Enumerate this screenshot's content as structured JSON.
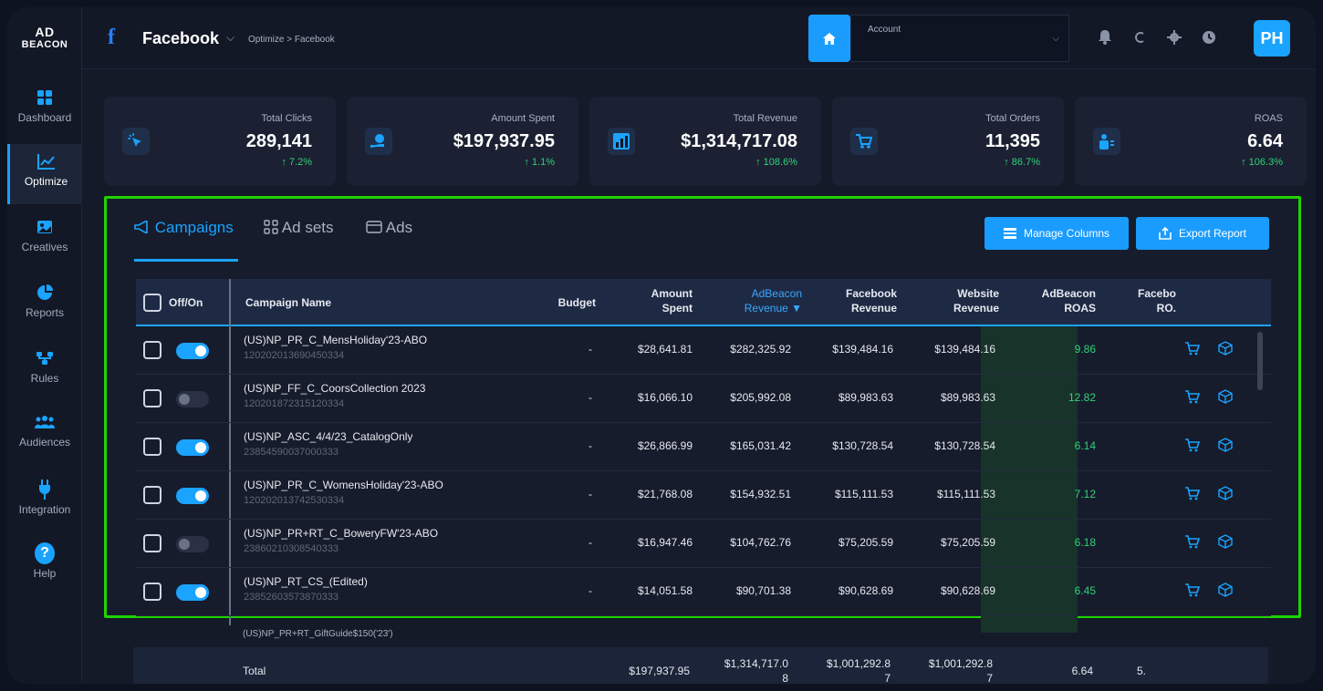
{
  "app": {
    "logo_line1": "AD",
    "logo_line2": "BEACON"
  },
  "sidebar": {
    "items": [
      {
        "label": "Dashboard",
        "icon": "grid-icon"
      },
      {
        "label": "Optimize",
        "icon": "chart-line-icon",
        "active": true
      },
      {
        "label": "Creatives",
        "icon": "image-icon"
      },
      {
        "label": "Reports",
        "icon": "pie-chart-icon"
      },
      {
        "label": "Rules",
        "icon": "flow-icon"
      },
      {
        "label": "Audiences",
        "icon": "users-icon"
      },
      {
        "label": "Integration",
        "icon": "plug-icon"
      },
      {
        "label": "Help",
        "icon": "help-icon"
      }
    ]
  },
  "header": {
    "platform": "Facebook",
    "breadcrumb": "Optimize > Facebook",
    "account_label": "Account",
    "avatar": "PH",
    "accent": "#1aa3ff"
  },
  "stats": [
    {
      "title": "Total Clicks",
      "value": "289,141",
      "change": "↑ 7.2%"
    },
    {
      "title": "Amount Spent",
      "value": "$197,937.95",
      "change": "↑ 1.1%"
    },
    {
      "title": "Total Revenue",
      "value": "$1,314,717.08",
      "change": "↑ 108.6%"
    },
    {
      "title": "Total Orders",
      "value": "11,395",
      "change": "↑ 86.7%"
    },
    {
      "title": "ROAS",
      "value": "6.64",
      "change": "↑ 106.3%"
    }
  ],
  "tabs": {
    "campaigns": "Campaigns",
    "adsets": "Ad sets",
    "ads": "Ads"
  },
  "buttons": {
    "manage_columns": "Manage Columns",
    "export_report": "Export Report"
  },
  "table": {
    "headers": {
      "offon": "Off/On",
      "campaign_name": "Campaign Name",
      "budget": "Budget",
      "amount_spent_1": "Amount",
      "amount_spent_2": "Spent",
      "adbeacon_rev_1": "AdBeacon",
      "adbeacon_rev_2": "Revenue ▼",
      "fb_rev_1": "Facebook",
      "fb_rev_2": "Revenue",
      "web_rev_1": "Website",
      "web_rev_2": "Revenue",
      "ab_roas_1": "AdBeacon",
      "ab_roas_2": "ROAS",
      "fb_roas_1": "Facebo",
      "fb_roas_2": "RO."
    },
    "rows": [
      {
        "name": "(US)NP_PR_C_MensHoliday'23-ABO",
        "id": "120202013690450334",
        "on": true,
        "budget": "-",
        "spent": "$28,641.81",
        "ab_rev": "$282,325.92",
        "fb_rev": "$139,484.16",
        "web_rev": "$139,484.16",
        "ab_roas": "9.86"
      },
      {
        "name": "(US)NP_FF_C_CoorsCollection 2023",
        "id": "120201872315120334",
        "on": false,
        "budget": "-",
        "spent": "$16,066.10",
        "ab_rev": "$205,992.08",
        "fb_rev": "$89,983.63",
        "web_rev": "$89,983.63",
        "ab_roas": "12.82"
      },
      {
        "name": "(US)NP_ASC_4/4/23_CatalogOnly",
        "id": "23854590037000333",
        "on": true,
        "budget": "-",
        "spent": "$26,866.99",
        "ab_rev": "$165,031.42",
        "fb_rev": "$130,728.54",
        "web_rev": "$130,728.54",
        "ab_roas": "6.14"
      },
      {
        "name": "(US)NP_PR_C_WomensHoliday'23-ABO",
        "id": "120202013742530334",
        "on": true,
        "budget": "-",
        "spent": "$21,768.08",
        "ab_rev": "$154,932.51",
        "fb_rev": "$115,111.53",
        "web_rev": "$115,111.53",
        "ab_roas": "7.12"
      },
      {
        "name": "(US)NP_PR+RT_C_BoweryFW'23-ABO",
        "id": "23860210308540333",
        "on": false,
        "budget": "-",
        "spent": "$16,947.46",
        "ab_rev": "$104,762.76",
        "fb_rev": "$75,205.59",
        "web_rev": "$75,205.59",
        "ab_roas": "6.18"
      },
      {
        "name": "(US)NP_RT_CS_(Edited)",
        "id": "23852603573870333",
        "on": true,
        "budget": "-",
        "spent": "$14,051.58",
        "ab_rev": "$90,701.38",
        "fb_rev": "$90,628.69",
        "web_rev": "$90,628.69",
        "ab_roas": "6.45"
      }
    ],
    "partial_row": "(US)NP_PR+RT_GiftGuide$150('23')",
    "total": {
      "label": "Total",
      "spent": "$197,937.95",
      "ab_rev_1": "$1,314,717.0",
      "ab_rev_2": "8",
      "fb_rev_1": "$1,001,292.8",
      "fb_rev_2": "7",
      "web_rev_1": "$1,001,292.8",
      "web_rev_2": "7",
      "ab_roas": "6.64",
      "fb_roas": "5."
    }
  }
}
